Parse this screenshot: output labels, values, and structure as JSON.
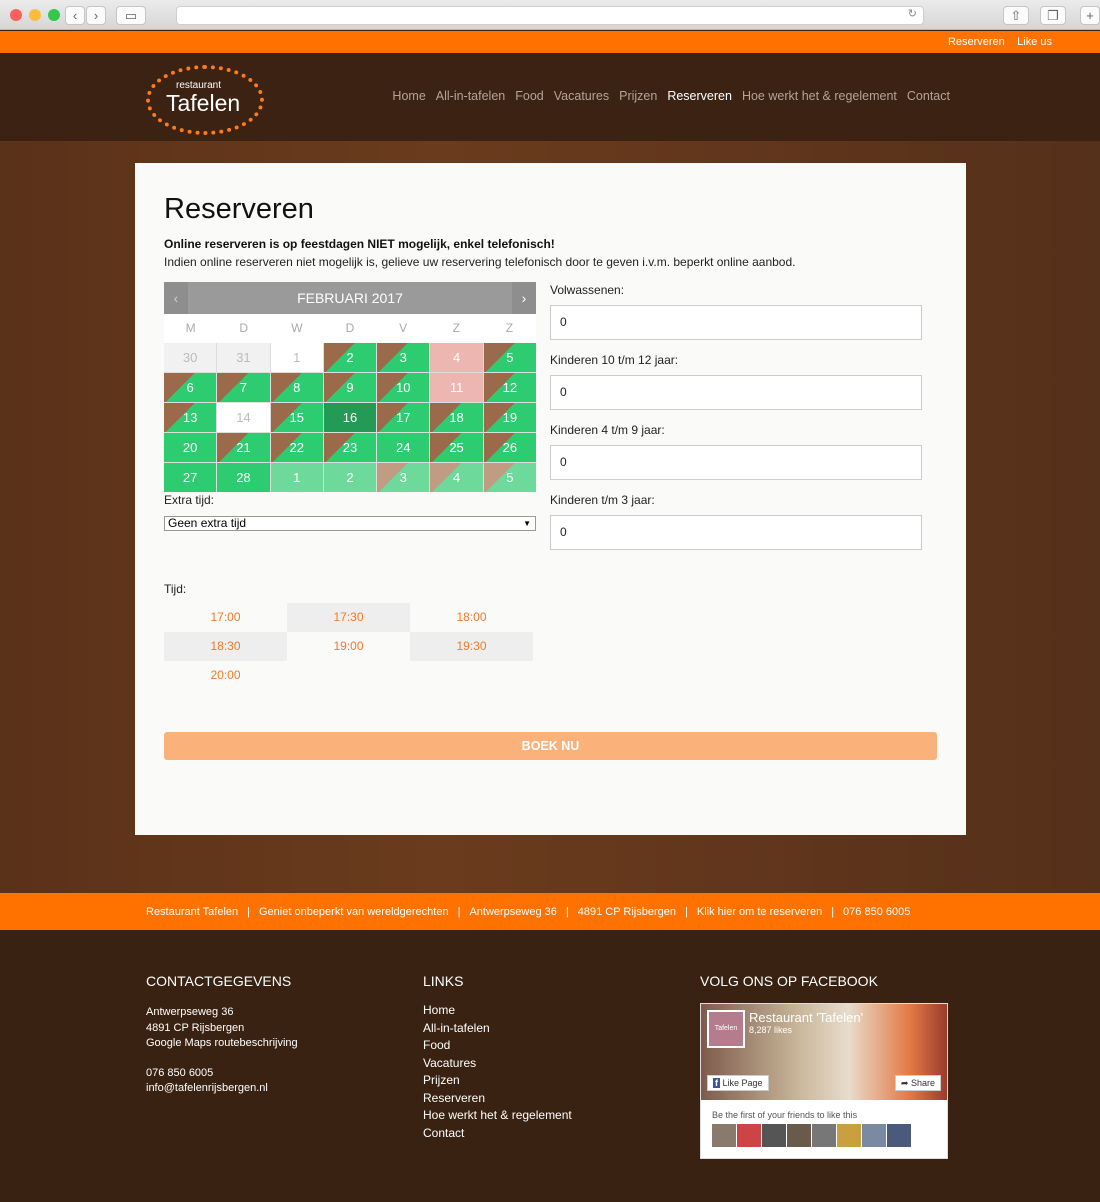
{
  "topbar": {
    "links": [
      "Reserveren",
      "Like us"
    ]
  },
  "logo": {
    "small": "restaurant",
    "name": "Tafelen"
  },
  "nav": {
    "items": [
      "Home",
      "All-in-tafelen",
      "Food",
      "Vacatures",
      "Prijzen",
      "Reserveren",
      "Hoe werkt het & regelement",
      "Contact"
    ],
    "active": "Reserveren"
  },
  "page": {
    "title": "Reserveren",
    "notice_bold": "Online reserveren is op feestdagen NIET mogelijk, enkel telefonisch!",
    "notice": "Indien online reserveren niet mogelijk is, gelieve uw reservering telefonisch door te geven i.v.m. beperkt online aanbod."
  },
  "calendar": {
    "month": "FEBRUARI 2017",
    "prev": "‹",
    "next": "›",
    "weekdays": [
      "M",
      "D",
      "W",
      "D",
      "V",
      "Z",
      "Z"
    ],
    "days": [
      {
        "d": "30",
        "s": "out"
      },
      {
        "d": "31",
        "s": "out"
      },
      {
        "d": "1",
        "s": "white"
      },
      {
        "d": "2",
        "s": "split"
      },
      {
        "d": "3",
        "s": "split"
      },
      {
        "d": "4",
        "s": "pink"
      },
      {
        "d": "5",
        "s": "split"
      },
      {
        "d": "6",
        "s": "split"
      },
      {
        "d": "7",
        "s": "split"
      },
      {
        "d": "8",
        "s": "split"
      },
      {
        "d": "9",
        "s": "split"
      },
      {
        "d": "10",
        "s": "split"
      },
      {
        "d": "11",
        "s": "pink"
      },
      {
        "d": "12",
        "s": "split"
      },
      {
        "d": "13",
        "s": "split"
      },
      {
        "d": "14",
        "s": "white"
      },
      {
        "d": "15",
        "s": "split"
      },
      {
        "d": "16",
        "s": "sel"
      },
      {
        "d": "17",
        "s": "split"
      },
      {
        "d": "18",
        "s": "split"
      },
      {
        "d": "19",
        "s": "split"
      },
      {
        "d": "20",
        "s": "green"
      },
      {
        "d": "21",
        "s": "split"
      },
      {
        "d": "22",
        "s": "split"
      },
      {
        "d": "23",
        "s": "split"
      },
      {
        "d": "24",
        "s": "green"
      },
      {
        "d": "25",
        "s": "split"
      },
      {
        "d": "26",
        "s": "split"
      },
      {
        "d": "27",
        "s": "green"
      },
      {
        "d": "28",
        "s": "green"
      },
      {
        "d": "1",
        "s": "next"
      },
      {
        "d": "2",
        "s": "next"
      },
      {
        "d": "3",
        "s": "nextsplit"
      },
      {
        "d": "4",
        "s": "nextsplit"
      },
      {
        "d": "5",
        "s": "nextsplit"
      }
    ],
    "selected": "16"
  },
  "extra": {
    "label": "Extra tijd:",
    "value": "Geen extra tijd"
  },
  "guests": [
    {
      "label": "Volwassenen:",
      "value": "0"
    },
    {
      "label": "Kinderen 10 t/m 12 jaar:",
      "value": "0"
    },
    {
      "label": "Kinderen 4 t/m 9 jaar:",
      "value": "0"
    },
    {
      "label": "Kinderen t/m 3 jaar:",
      "value": "0"
    }
  ],
  "time": {
    "label": "Tijd:",
    "slots": [
      "17:00",
      "17:30",
      "18:00",
      "18:30",
      "19:00",
      "19:30",
      "20:00"
    ]
  },
  "book_label": "BOEK NU",
  "footer_bar": [
    "Restaurant Tafelen",
    "Geniet onbeperkt van wereldgerechten",
    "Antwerpseweg 36",
    "4891 CP Rijsbergen",
    "Klik hier om te reserveren",
    "076 850 6005"
  ],
  "contact": {
    "title": "CONTACTGEGEVENS",
    "lines": [
      "Antwerpseweg 36",
      "4891 CP Rijsbergen",
      "Google Maps routebeschrijving"
    ],
    "phone": "076 850 6005",
    "email": "info@tafelenrijsbergen.nl"
  },
  "links": {
    "title": "LINKS",
    "items": [
      "Home",
      "All-in-tafelen",
      "Food",
      "Vacatures",
      "Prijzen",
      "Reserveren",
      "Hoe werkt het & regelement",
      "Contact"
    ]
  },
  "facebook": {
    "title": "VOLG ONS OP FACEBOOK",
    "page": "Restaurant 'Tafelen'",
    "likes": "8,287 likes",
    "like_btn": "Like Page",
    "share_btn": "Share",
    "friends": "Be the first of your friends to like this",
    "thumb": "Tafelen"
  },
  "colors": {
    "accent": "#ff7200",
    "available": "#2ecc71",
    "selected": "#239a55",
    "closed": "#eeb6b1"
  }
}
